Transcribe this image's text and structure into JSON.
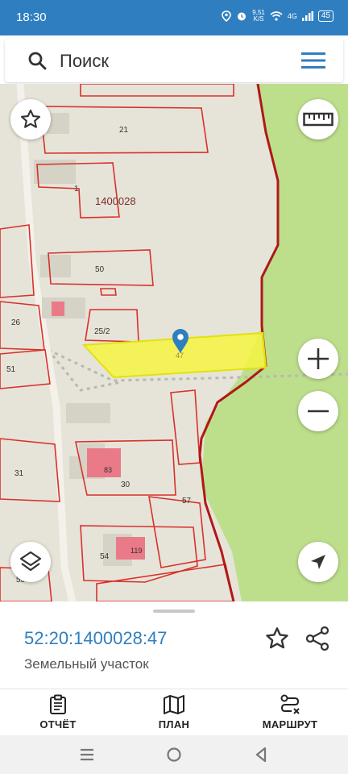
{
  "status": {
    "time": "18:30",
    "net_speed_value": "9,51",
    "net_speed_unit": "K/S",
    "network": "4G",
    "battery": "45"
  },
  "search": {
    "placeholder": "Поиск"
  },
  "map": {
    "parcel_labels": [
      "21",
      "1",
      "50",
      "25/2",
      "26",
      "51",
      "31",
      "30",
      "57",
      "54",
      "53"
    ],
    "block_label": "1400028",
    "building_labels": [
      "83",
      "119"
    ],
    "selected_parcel_label": "47",
    "colors": {
      "parcel_border": "#d9302b",
      "selected_fill": "#f4f442",
      "forest": "#bddf8c",
      "dark_border": "#b01818"
    }
  },
  "map_controls": {
    "favorite": "star-icon",
    "ruler": "ruler-icon",
    "zoom_in": "plus-icon",
    "zoom_out": "minus-icon",
    "layers": "layers-icon",
    "location": "navigation-arrow-icon"
  },
  "object": {
    "id": "52:20:1400028:47",
    "type": "Земельный участок"
  },
  "bottom_nav": [
    {
      "label": "ОТЧЁТ",
      "icon": "report-icon"
    },
    {
      "label": "ПЛАН",
      "icon": "map-plan-icon"
    },
    {
      "label": "МАРШРУТ",
      "icon": "route-icon"
    }
  ],
  "colors": {
    "accent": "#2f7fc0"
  }
}
